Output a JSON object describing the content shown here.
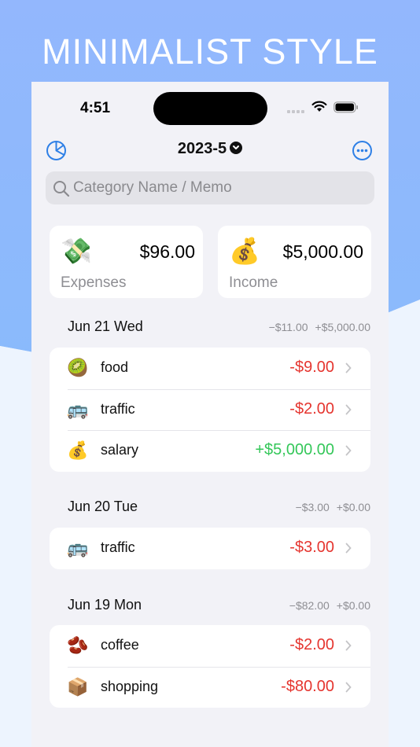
{
  "banner": {
    "headline": "MINIMALIST STYLE"
  },
  "status_bar": {
    "time": "4:51"
  },
  "nav": {
    "month": "2023-5"
  },
  "search": {
    "placeholder": "Category Name / Memo",
    "value": ""
  },
  "summary": {
    "expenses": {
      "icon": "money-with-wings",
      "emoji": "💸",
      "amount": "$96.00",
      "label": "Expenses"
    },
    "income": {
      "icon": "money-bag",
      "emoji": "💰",
      "amount": "$5,000.00",
      "label": "Income"
    }
  },
  "colors": {
    "accent": "#2f80e6",
    "expense": "#e5352f",
    "income": "#34c759",
    "banner": "#93b7fd"
  },
  "days": [
    {
      "date": "Jun 21  Wed",
      "expense_total": "−$11.00",
      "income_total": "+$5,000.00",
      "items": [
        {
          "icon": "kiwi-icon",
          "emoji": "🥝",
          "name": "food",
          "amount": "-$9.00",
          "type": "expense"
        },
        {
          "icon": "bus-icon",
          "emoji": "🚌",
          "name": "traffic",
          "amount": "-$2.00",
          "type": "expense"
        },
        {
          "icon": "money-bag-icon",
          "emoji": "💰",
          "name": "salary",
          "amount": "+$5,000.00",
          "type": "income"
        }
      ]
    },
    {
      "date": "Jun 20  Tue",
      "expense_total": "−$3.00",
      "income_total": "+$0.00",
      "items": [
        {
          "icon": "bus-icon",
          "emoji": "🚌",
          "name": "traffic",
          "amount": "-$3.00",
          "type": "expense"
        }
      ]
    },
    {
      "date": "Jun 19  Mon",
      "expense_total": "−$82.00",
      "income_total": "+$0.00",
      "items": [
        {
          "icon": "beans-icon",
          "emoji": "🫘",
          "name": "coffee",
          "amount": "-$2.00",
          "type": "expense"
        },
        {
          "icon": "package-icon",
          "emoji": "📦",
          "name": "shopping",
          "amount": "-$80.00",
          "type": "expense"
        }
      ]
    }
  ]
}
